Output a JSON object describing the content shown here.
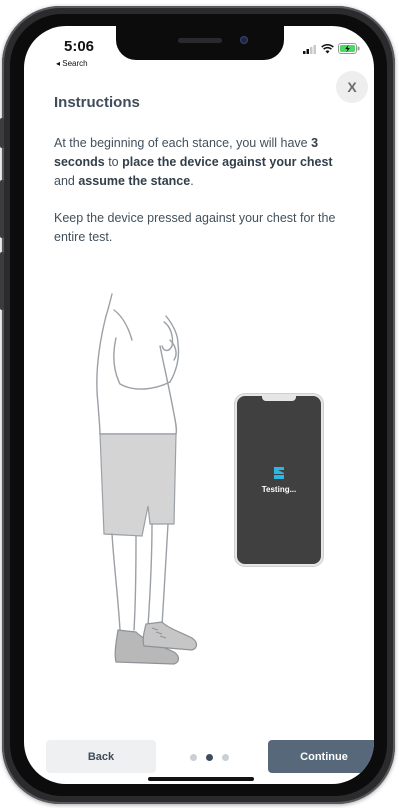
{
  "status_bar": {
    "time": "5:06",
    "back_label": "◂ Search"
  },
  "close_button": {
    "label": "X"
  },
  "instructions": {
    "title": "Instructions",
    "paragraph1": {
      "t1": "At the beginning of each stance, you will have ",
      "b1": "3 seconds",
      "t2": " to ",
      "b2": "place the device against your chest",
      "t3": " and ",
      "b3": "assume the stance",
      "t4": "."
    },
    "paragraph2": "Keep the device pressed against your chest for the entire test."
  },
  "illustration": {
    "phone_screen_label": "Testing..."
  },
  "pager": {
    "total": 3,
    "current": 2
  },
  "buttons": {
    "back_label": "Back",
    "continue_label": "Continue"
  },
  "colors": {
    "accent": "#56687a",
    "title": "#3f4d5b",
    "logo": "#29b8e3"
  }
}
